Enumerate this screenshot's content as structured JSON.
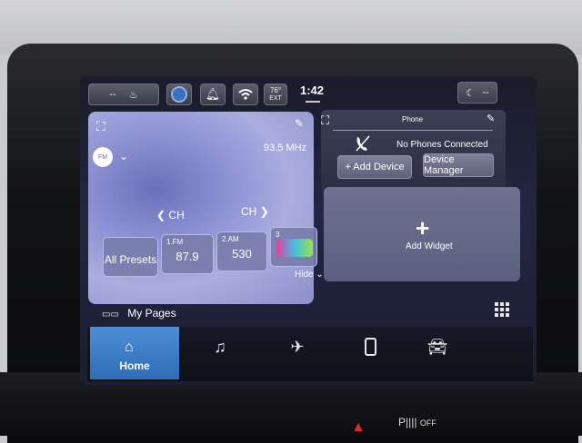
{
  "status_bar": {
    "seat_value": "--",
    "outside_temp": "76°",
    "outside_label": "EXT",
    "time": "1:42",
    "right_value": "--"
  },
  "radio": {
    "source": "FM",
    "frequency": "93.5 MHz",
    "ch_prev": "CH",
    "ch_next": "CH",
    "all_presets": "All Presets",
    "presets": [
      {
        "num": "1.FM",
        "value": "87.9"
      },
      {
        "num": "2.AM",
        "value": "530"
      },
      {
        "num": "3"
      }
    ],
    "hide": "Hide"
  },
  "phone": {
    "title": "Phone",
    "status": "No Phones Connected",
    "add_device": "+ Add Device",
    "device_manager": "Device Manager"
  },
  "widget": {
    "label": "Add Widget"
  },
  "nav": {
    "my_pages": "My Pages",
    "home": "Home"
  },
  "colors": {
    "home_tab": "#3a7cc8",
    "hazard": "#d82a2a"
  },
  "icons": [
    "expand-icon",
    "edit-icon",
    "chevron-down-icon",
    "chevron-left-icon",
    "chevron-right-icon",
    "heated-seat-icon",
    "driver-assist-icon",
    "bell-icon",
    "wifi-icon",
    "moon-icon",
    "no-phone-icon",
    "plus-icon",
    "home-icon",
    "music-icon",
    "climate-icon",
    "phone-icon",
    "car-icon",
    "apps-grid-icon",
    "hazard-icon"
  ]
}
